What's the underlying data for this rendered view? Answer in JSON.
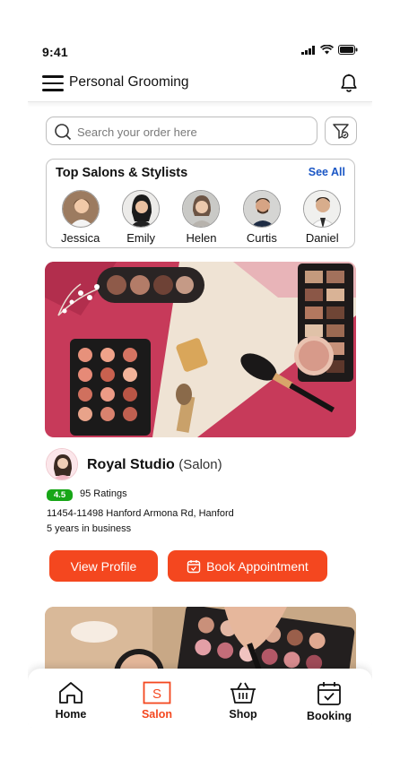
{
  "status_bar": {
    "time": "9:41"
  },
  "header": {
    "title": "Personal Grooming"
  },
  "search": {
    "placeholder": "Search your order here"
  },
  "top_salons": {
    "title": "Top Salons & Stylists",
    "see_all": "See All",
    "stylists": [
      {
        "name": "Jessica"
      },
      {
        "name": "Emily"
      },
      {
        "name": "Helen"
      },
      {
        "name": "Curtis"
      },
      {
        "name": "Daniel"
      }
    ]
  },
  "salon": {
    "name": "Royal Studio",
    "type": "(Salon)",
    "rating": "4.5",
    "ratings_count": "95 Ratings",
    "address": "11454-11498 Hanford Armona Rd, Hanford",
    "years": "5 years in business",
    "view_profile": "View Profile",
    "book": "Book Appointment"
  },
  "nav": {
    "items": [
      {
        "label": "Home",
        "icon": "home-icon"
      },
      {
        "label": "Salon",
        "icon": "salon-icon",
        "active": true
      },
      {
        "label": "Shop",
        "icon": "basket-icon"
      },
      {
        "label": "Booking",
        "icon": "calendar-check-icon"
      }
    ]
  },
  "colors": {
    "accent": "#f4471f",
    "link": "#1a56c5",
    "rating": "#17a617"
  }
}
